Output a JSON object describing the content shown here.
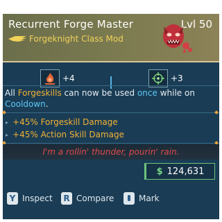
{
  "item": {
    "name": "Recurrent Forge Master",
    "level": "Lvl 50",
    "class_mod": "Forgeknight Class Mod",
    "manufacturer_icon": "wing-icon",
    "portrait_icon": "demon-mask-icon"
  },
  "skills": [
    {
      "icon": "flame-skill-icon",
      "value": "+4"
    },
    {
      "icon": "crosshair-skill-icon",
      "value": "+3"
    }
  ],
  "description": {
    "p1": "All ",
    "hl1": "Forgeskills",
    "p2": " can now be used ",
    "hl2": "once",
    "p3": " while on",
    "hl3": "Cooldown",
    "p4": "."
  },
  "bonuses": [
    {
      "value": "+45%",
      "label": "Forgeskill Damage"
    },
    {
      "value": "+45%",
      "label": "Action Skill Damage"
    }
  ],
  "flavor_text": "I'm a rollin' thunder, pourin' rain.",
  "price": {
    "symbol": "$",
    "value": "124,631"
  },
  "actions": [
    {
      "key": "Y",
      "label": "Inspect"
    },
    {
      "key": "R",
      "label": "Compare"
    },
    {
      "key": "",
      "label": "Mark"
    }
  ],
  "colors": {
    "panel": "#1a3c55",
    "highlight_orange": "#f2b234",
    "highlight_blue": "#5cc8f5",
    "flavor_red": "#e04a4a",
    "price_green": "#6cc37e"
  }
}
